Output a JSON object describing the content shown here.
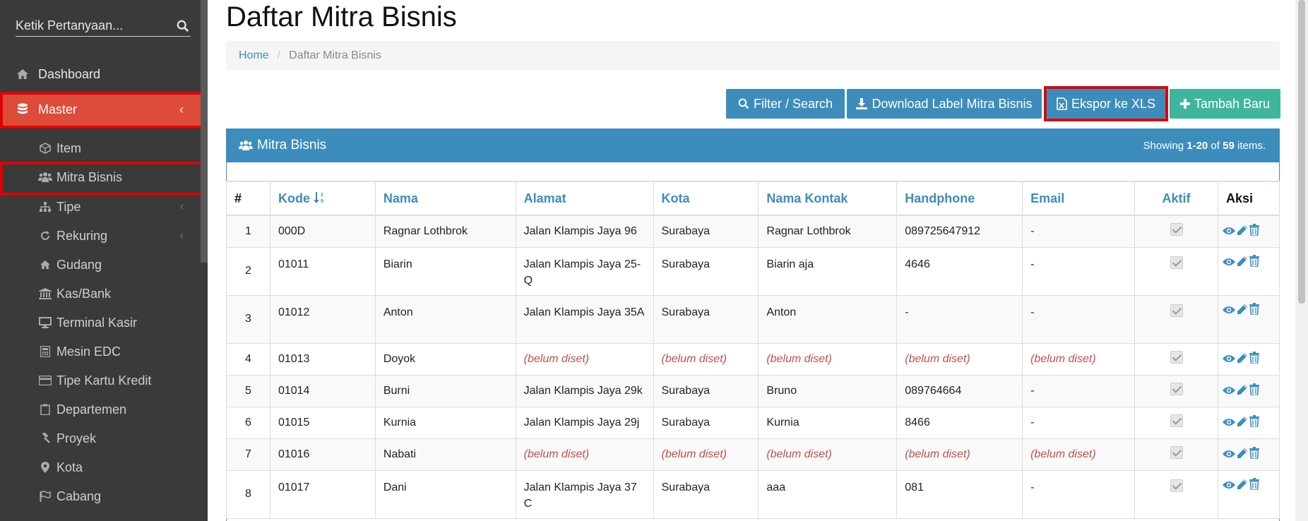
{
  "search": {
    "placeholder": "Ketik Pertanyaan..."
  },
  "sidebar": {
    "main": [
      {
        "label": "Dashboard",
        "icon": "home-icon"
      },
      {
        "label": "Master",
        "icon": "database-icon",
        "active": true
      }
    ],
    "sub": [
      {
        "label": "Item",
        "icon": "cube-icon"
      },
      {
        "label": "Mitra Bisnis",
        "icon": "users-icon",
        "highlighted": true
      },
      {
        "label": "Tipe",
        "icon": "sitemap-icon",
        "has_children": true
      },
      {
        "label": "Rekuring",
        "icon": "refresh-icon",
        "has_children": true
      },
      {
        "label": "Gudang",
        "icon": "home-icon"
      },
      {
        "label": "Kas/Bank",
        "icon": "bank-icon"
      },
      {
        "label": "Terminal Kasir",
        "icon": "desktop-icon"
      },
      {
        "label": "Mesin EDC",
        "icon": "calculator-icon"
      },
      {
        "label": "Tipe Kartu Kredit",
        "icon": "credit-card-icon"
      },
      {
        "label": "Departemen",
        "icon": "clipboard-icon"
      },
      {
        "label": "Proyek",
        "icon": "gavel-icon"
      },
      {
        "label": "Kota",
        "icon": "map-marker-icon"
      },
      {
        "label": "Cabang",
        "icon": "flag-icon"
      }
    ]
  },
  "page": {
    "title": "Daftar Mitra Bisnis"
  },
  "breadcrumb": {
    "home": "Home",
    "separator": "/",
    "current": "Daftar Mitra Bisnis"
  },
  "toolbar": {
    "filter_label": "Filter / Search",
    "download_label": "Download Label Mitra Bisnis",
    "export_label": "Ekspor ke XLS",
    "add_label": "Tambah Baru"
  },
  "panel": {
    "title": "Mitra Bisnis",
    "showing_prefix": "Showing ",
    "range": "1-20",
    "of": " of ",
    "total": "59",
    "suffix": " items."
  },
  "table": {
    "headers": [
      "#",
      "Kode",
      "Nama",
      "Alamat",
      "Kota",
      "Nama Kontak",
      "Handphone",
      "Email",
      "Aktif",
      "Aksi"
    ],
    "unset_text": "(belum diset)",
    "rows": [
      {
        "num": "1",
        "kode": "000D",
        "nama": "Ragnar Lothbrok",
        "alamat": "Jalan Klampis Jaya 96",
        "kota": "Surabaya",
        "kontak": "Ragnar Lothbrok",
        "hp": "089725647912",
        "email": "-"
      },
      {
        "num": "2",
        "kode": "01011",
        "nama": "Biarin",
        "alamat": "Jalan Klampis Jaya 25-Q",
        "kota": "Surabaya",
        "kontak": "Biarin aja",
        "hp": "4646",
        "email": "-"
      },
      {
        "num": "3",
        "kode": "01012",
        "nama": "Anton",
        "alamat": "Jalan Klampis Jaya 35A",
        "kota": "Surabaya",
        "kontak": "Anton",
        "hp": "-",
        "email": "-"
      },
      {
        "num": "4",
        "kode": "01013",
        "nama": "Doyok",
        "alamat": "(belum diset)",
        "kota": "(belum diset)",
        "kontak": "(belum diset)",
        "hp": "(belum diset)",
        "email": "(belum diset)"
      },
      {
        "num": "5",
        "kode": "01014",
        "nama": "Burni",
        "alamat": "Jalan Klampis Jaya 29k",
        "kota": "Surabaya",
        "kontak": "Bruno",
        "hp": "089764664",
        "email": "-"
      },
      {
        "num": "6",
        "kode": "01015",
        "nama": "Kurnia",
        "alamat": "Jalan Klampis Jaya 29j",
        "kota": "Surabaya",
        "kontak": "Kurnia",
        "hp": "8466",
        "email": "-"
      },
      {
        "num": "7",
        "kode": "01016",
        "nama": "Nabati",
        "alamat": "(belum diset)",
        "kota": "(belum diset)",
        "kontak": "(belum diset)",
        "hp": "(belum diset)",
        "email": "(belum diset)"
      },
      {
        "num": "8",
        "kode": "01017",
        "nama": "Dani",
        "alamat": "Jalan Klampis Jaya 37 C",
        "kota": "Surabaya",
        "kontak": "aaa",
        "hp": "081",
        "email": "-"
      }
    ]
  },
  "colors": {
    "primary": "#3c8dbc",
    "success": "#3fb59e",
    "danger": "#dd4b39",
    "highlight": "#e00000",
    "sidebar": "#3a3a3a"
  }
}
